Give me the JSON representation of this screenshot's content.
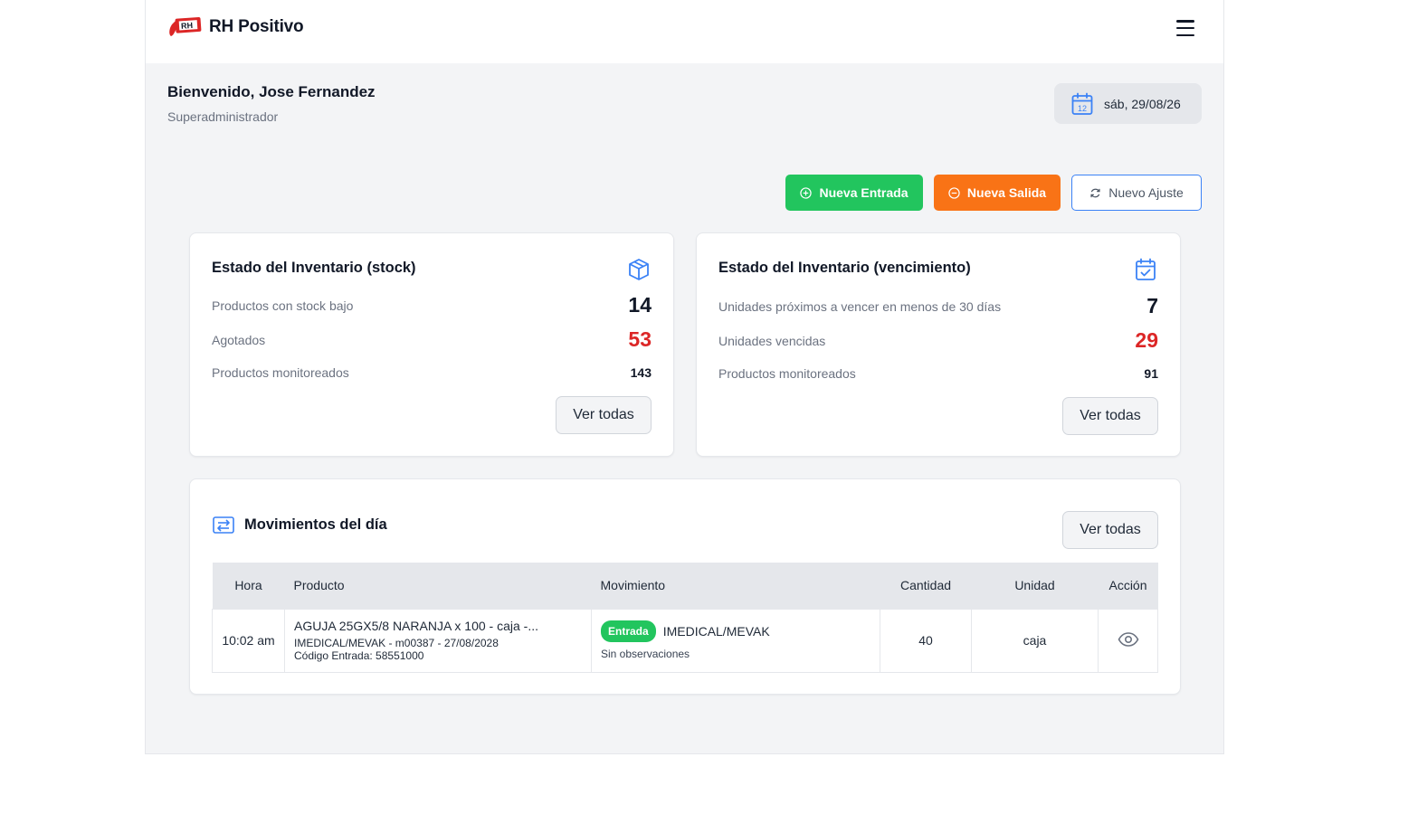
{
  "header": {
    "logo_text": "RH Positivo",
    "logo_badge": "RH",
    "menu_icon": "hamburger-icon"
  },
  "welcome": {
    "title": "Bienvenido, Jose Fernandez",
    "role": "Superadministrador"
  },
  "date": {
    "icon": "calendar-icon",
    "icon_day": "12",
    "value": "sáb, 29/08/26"
  },
  "actions": {
    "nueva_entrada": "Nueva Entrada",
    "nueva_salida": "Nueva Salida",
    "nuevo_ajuste": "Nuevo Ajuste"
  },
  "stock_card": {
    "title": "Estado del Inventario (stock)",
    "icon": "box-icon",
    "rows": [
      {
        "label": "Productos con stock bajo",
        "value": "14"
      },
      {
        "label": "Agotados",
        "value": "53"
      },
      {
        "label": "Productos monitoreados",
        "value": "143"
      }
    ],
    "button": "Ver todas"
  },
  "venc_card": {
    "title": "Estado del Inventario (vencimiento)",
    "icon": "calendar-check-icon",
    "rows": [
      {
        "label": "Unidades próximos a vencer en menos de 30 días",
        "value": "7"
      },
      {
        "label": "Unidades vencidas",
        "value": "29"
      },
      {
        "label": "Productos monitoreados",
        "value": "91"
      }
    ],
    "button": "Ver todas"
  },
  "movements": {
    "title": "Movimientos del día",
    "icon": "arrows-exchange-icon",
    "button": "Ver todas",
    "columns": [
      "Hora",
      "Producto",
      "Movimiento",
      "Cantidad",
      "Unidad",
      "Acción"
    ],
    "rows": [
      {
        "hora": "10:02 am",
        "producto": "AGUJA 25GX5/8 NARANJA x 100 - caja -...",
        "producto_detalle": "IMEDICAL/MEVAK -  m00387 - 27/08/2028",
        "producto_codigo": "Código Entrada: 58551000",
        "movimiento_tipo": "Entrada",
        "movimiento_proveedor": "IMEDICAL/MEVAK",
        "movimiento_obs": "Sin observaciones",
        "cantidad": "40",
        "unidad": "caja",
        "accion_icon": "eye-icon"
      }
    ]
  },
  "colors": {
    "green": "#22c55e",
    "orange": "#f97316",
    "blue": "#3b82f6",
    "red": "#dc2626"
  }
}
